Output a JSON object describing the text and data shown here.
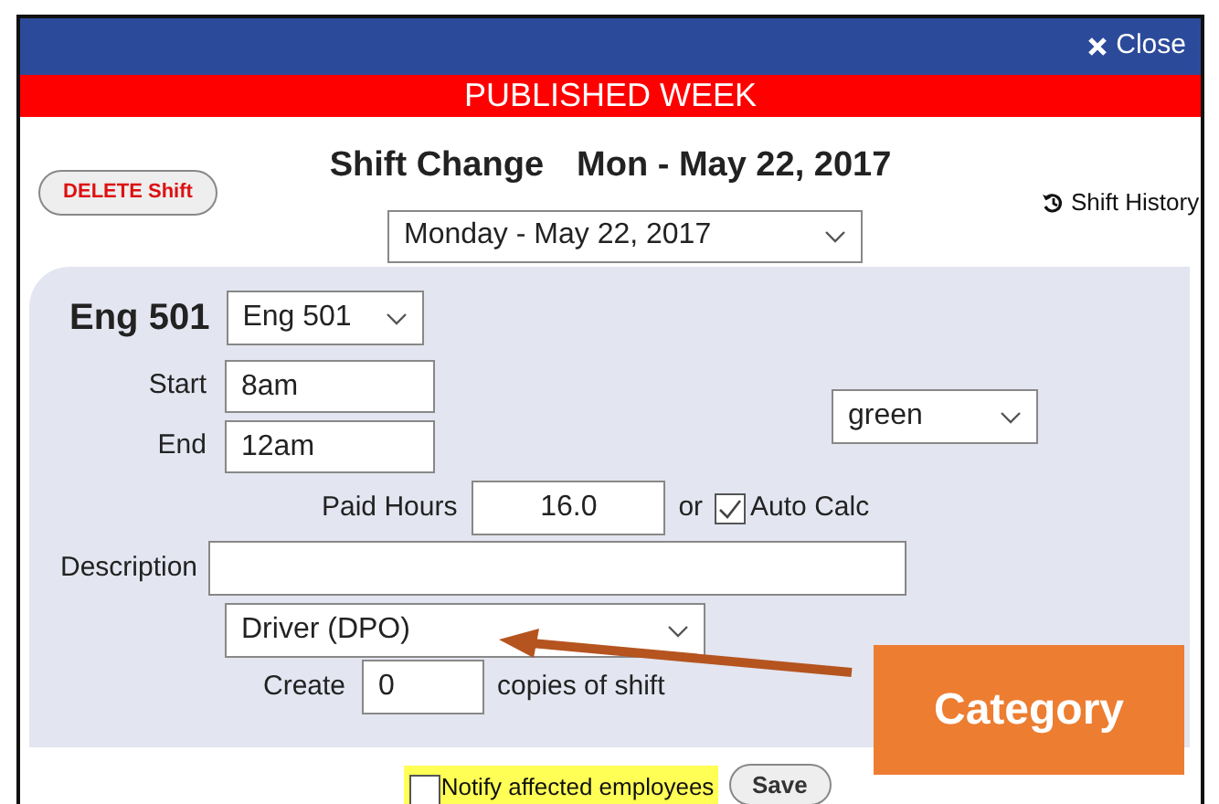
{
  "header": {
    "close": "Close"
  },
  "banner": "PUBLISHED WEEK",
  "title": {
    "heading": "Shift Change",
    "date": "Mon - May 22, 2017"
  },
  "delete_button": "DELETE Shift",
  "history_link": "Shift History",
  "date_select": "Monday - May 22, 2017",
  "form": {
    "unit_label": "Eng 501",
    "unit_select": "Eng 501",
    "start_label": "Start",
    "start": "8am",
    "end_label": "End",
    "end": "12am",
    "color_select": "green",
    "paid_hours_label": "Paid Hours",
    "paid_hours": "16.0",
    "or": "or",
    "auto_calc": {
      "label": "Auto Calc",
      "checked": true
    },
    "description_label": "Description",
    "category_select": "Driver (DPO)",
    "create_label": "Create",
    "copies": "0",
    "copies_suffix": "copies of shift"
  },
  "notify": {
    "label": "Notify affected employees",
    "checked": false
  },
  "save": "Save",
  "callout": {
    "label": "Category"
  }
}
